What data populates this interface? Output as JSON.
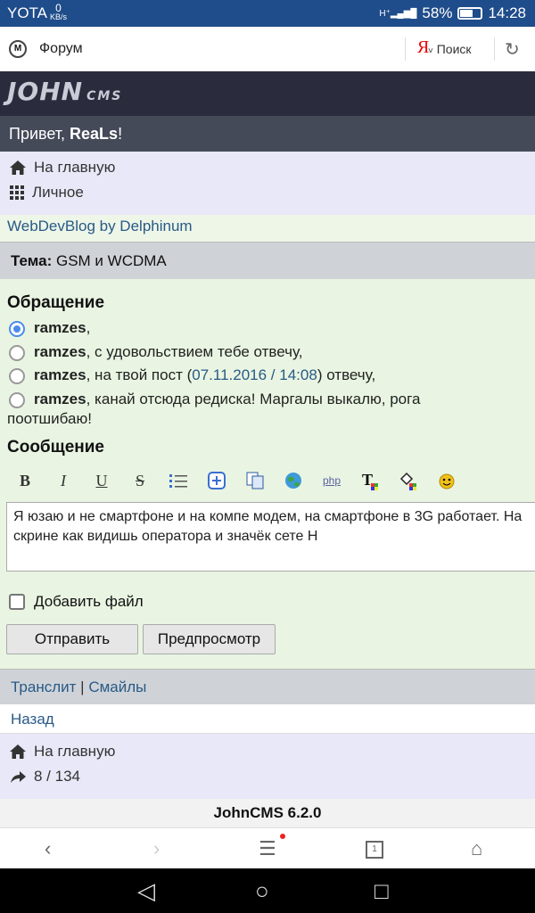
{
  "status": {
    "carrier": "YOTA",
    "speed_value": "0",
    "speed_unit": "KB/s",
    "battery": "58%",
    "time": "14:28"
  },
  "browser": {
    "site_name": "Форум",
    "search_brand": "Я",
    "search_label": "Поиск"
  },
  "header": {
    "logo_main": "JOHN",
    "logo_sub": "CMS",
    "greeting_prefix": "Привет, ",
    "user": "ReaLs",
    "greeting_suffix": "!"
  },
  "nav_top": {
    "home": "На главную",
    "personal": "Личное"
  },
  "blog_link": "WebDevBlog by Delphinum",
  "topic": {
    "label": "Тема:",
    "value": "GSM и WCDMA"
  },
  "appeal": {
    "heading": "Обращение",
    "options": [
      {
        "name": "ramzes",
        "text": ","
      },
      {
        "name": "ramzes",
        "text": ", с удовольствием тебе отвечу,"
      },
      {
        "name": "ramzes",
        "text_before": ", на твой пост (",
        "link": "07.11.2016 / 14:08",
        "text_after": ") отвечу,"
      },
      {
        "name": "ramzes",
        "text": ", канай отсюда редиска! Маргалы выкалю, рога",
        "text_line2": "поотшибаю!"
      }
    ]
  },
  "message": {
    "heading": "Сообщение",
    "text": "Я юзаю и не смартфоне и на компе модем, на смартфоне в 3G работает. На скрине как видишь оператора и значёк сете H"
  },
  "toolbar_icons": [
    "bold-icon",
    "italic-icon",
    "underline-icon",
    "strike-icon",
    "list-icon",
    "add-icon",
    "copy-icon",
    "globe-icon",
    "php-icon",
    "text-color-icon",
    "bg-color-icon",
    "smile-icon"
  ],
  "attach_label": "Добавить файл",
  "buttons": {
    "send": "Отправить",
    "preview": "Предпросмотр"
  },
  "translit": {
    "translit": "Транслит",
    "sep": " | ",
    "smiles": "Смайлы"
  },
  "back": "Назад",
  "nav_bottom": {
    "home": "На главную",
    "counter": "8 / 134"
  },
  "footer": "JohnCMS 6.2.0",
  "browser_nav": {
    "tab_count": "1"
  }
}
